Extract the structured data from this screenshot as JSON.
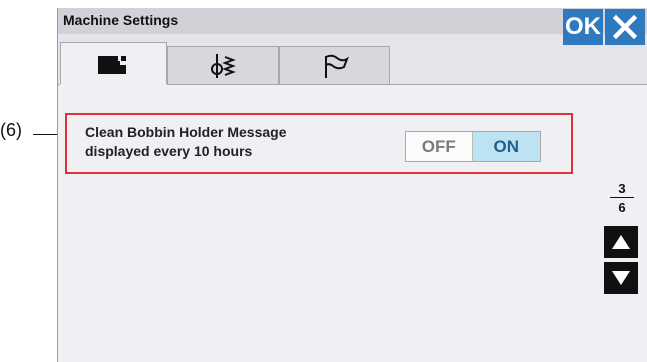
{
  "screen": {
    "title": "Machine Settings",
    "ok_label": "OK",
    "close_icon": "close-icon"
  },
  "tabs": [
    {
      "name": "tab-machine",
      "icon": "sewing-machine-icon",
      "active": true
    },
    {
      "name": "tab-stitch",
      "icon": "stitch-needle-icon",
      "active": false
    },
    {
      "name": "tab-general",
      "icon": "flag-icon",
      "active": false
    }
  ],
  "setting": {
    "label_line1": "Clean Bobbin Holder Message",
    "label_line2": "displayed every 10 hours",
    "off_label": "OFF",
    "on_label": "ON",
    "selected": "ON"
  },
  "pagination": {
    "current": "3",
    "total": "6"
  },
  "annotation": {
    "callout_label": "(6)"
  },
  "colors": {
    "accent_blue": "#2f79bf",
    "highlight_red": "#e1322e",
    "toggle_on_bg": "#bde3f2"
  }
}
